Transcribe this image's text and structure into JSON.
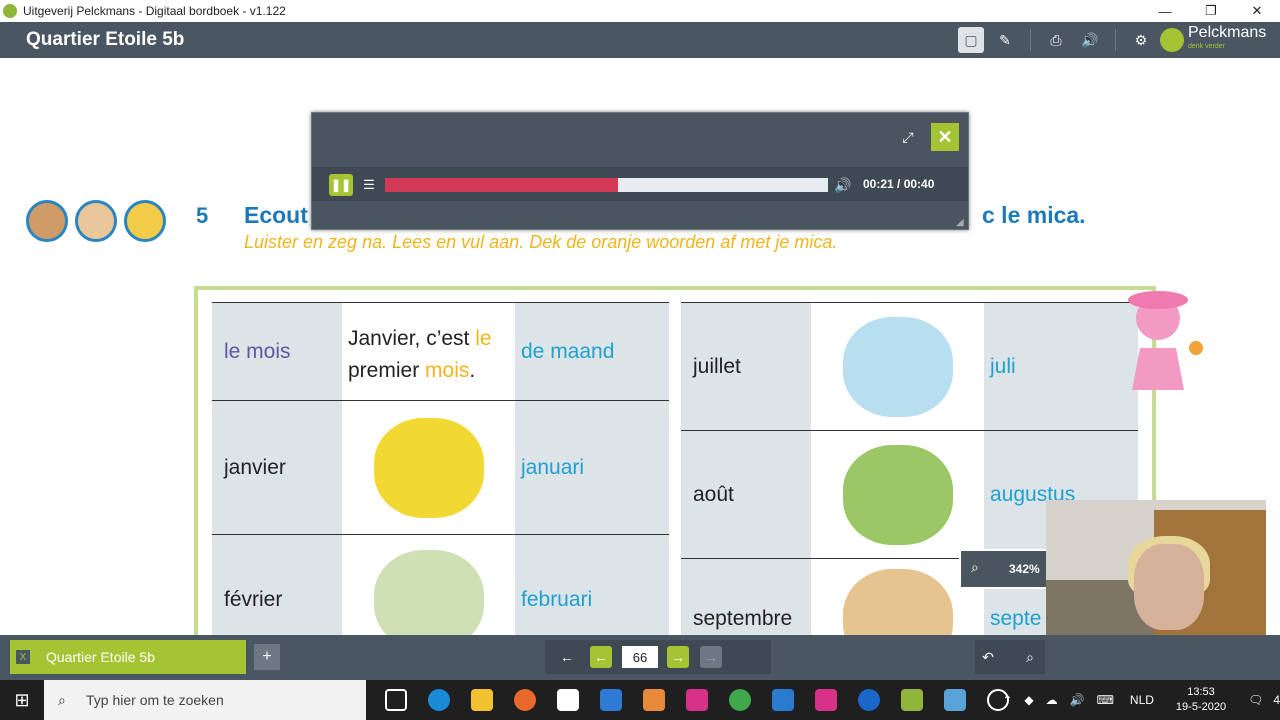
{
  "window": {
    "title": "Uitgeverij Pelckmans - Digitaal bordboek - v1.122",
    "min": "—",
    "max": "❐",
    "close": "✕"
  },
  "app": {
    "book_title": "Quartier Etoile 5b",
    "brand_name": "Pelckmans",
    "brand_tagline": "denk verder",
    "toolbar_icons": [
      "window-icon",
      "pen-icon",
      "print-icon",
      "speaker-icon",
      "settings-icon"
    ]
  },
  "exercise": {
    "number": "5",
    "title_start": "Ecout",
    "title_end": "c le mica.",
    "subtitle": "Luister en zeg na.  Lees en vul aan. Dek de oranje woorden af met je mica."
  },
  "table_left": [
    {
      "fr": "le mois",
      "sentence_a": "Janvier, c’est ",
      "sentence_b": "le",
      "sentence_c": "premier ",
      "sentence_d": "mois",
      "sentence_e": ".",
      "nl": "de maand"
    },
    {
      "fr": "janvier",
      "nl": "januari",
      "image": "celebration-illustration"
    },
    {
      "fr": "février",
      "nl": "februari",
      "image": "couple-bench-illustration"
    }
  ],
  "table_right": [
    {
      "fr": "juillet",
      "nl": "juli",
      "image": "swimming-illustration"
    },
    {
      "fr": "août",
      "nl": "augustus",
      "image": "hammock-illustration"
    },
    {
      "fr": "septembre",
      "nl": "septe",
      "image": "school-illustration"
    }
  ],
  "player": {
    "time": "00:21 / 00:40",
    "progress": 0.525
  },
  "zoom": {
    "value": "342%"
  },
  "bottom": {
    "tab_label": "Quartier Etoile 5b",
    "tab_close": "X",
    "add": "+",
    "page": "66"
  },
  "taskbar": {
    "search_placeholder": "Typ hier om te zoeken",
    "lang": "NLD",
    "time": "13:53",
    "date": "19-5-2020",
    "notifications": "4"
  },
  "colors": {
    "accent_green": "#a5c433",
    "app_bar": "#4a5662",
    "title_blue": "#1c7ab8",
    "instruction_orange": "#f0b41d",
    "progress_red": "#d33a55"
  }
}
